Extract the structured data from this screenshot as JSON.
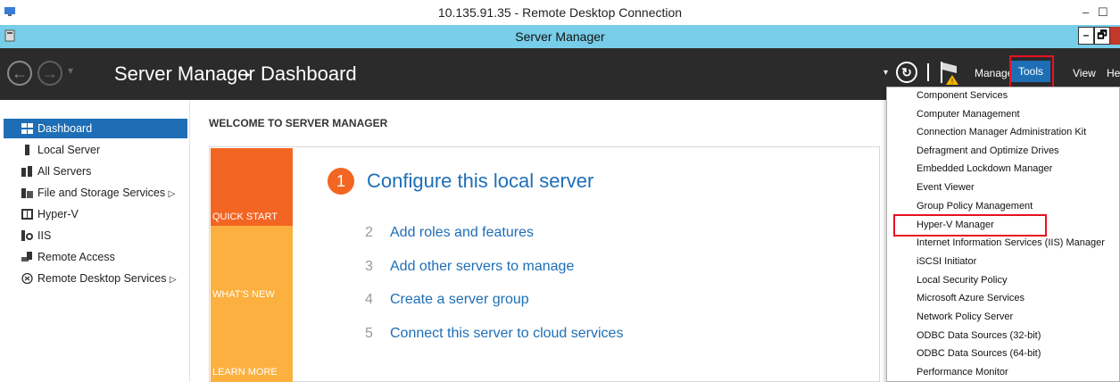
{
  "rdp": {
    "title": "10.135.91.35 - Remote Desktop Connection",
    "minimize": "–",
    "restore": "☐"
  },
  "window": {
    "title": "Server Manager",
    "minimize": "–",
    "restore": "🗗"
  },
  "header": {
    "breadcrumb_root": "Server Manager",
    "breadcrumb_sep": "▸",
    "breadcrumb_page": "Dashboard",
    "menus": {
      "manage": "Manage",
      "tools": "Tools",
      "view": "View",
      "help": "He"
    }
  },
  "sidebar": {
    "items": [
      {
        "label": "Dashboard",
        "icon": "dashboard-icon",
        "active": true
      },
      {
        "label": "Local Server",
        "icon": "server-icon"
      },
      {
        "label": "All Servers",
        "icon": "servers-icon"
      },
      {
        "label": "File and Storage Services",
        "icon": "storage-icon",
        "expand": "▷"
      },
      {
        "label": "Hyper-V",
        "icon": "hyperv-icon"
      },
      {
        "label": "IIS",
        "icon": "iis-icon"
      },
      {
        "label": "Remote Access",
        "icon": "remote-access-icon"
      },
      {
        "label": "Remote Desktop Services",
        "icon": "remote-desktop-icon",
        "expand": "▷"
      }
    ]
  },
  "main": {
    "welcome": "WELCOME TO SERVER MANAGER",
    "tiles": {
      "quick_start": "QUICK START",
      "whats_new": "WHAT'S NEW",
      "learn_more": "LEARN MORE"
    },
    "step1": {
      "num": "1",
      "label": "Configure this local server"
    },
    "steps": [
      {
        "num": "2",
        "label": "Add roles and features"
      },
      {
        "num": "3",
        "label": "Add other servers to manage"
      },
      {
        "num": "4",
        "label": "Create a server group"
      },
      {
        "num": "5",
        "label": "Connect this server to cloud services"
      }
    ]
  },
  "tools_menu": {
    "items": [
      "Component Services",
      "Computer Management",
      "Connection Manager Administration Kit",
      "Defragment and Optimize Drives",
      "Embedded Lockdown Manager",
      "Event Viewer",
      "Group Policy Management",
      "Hyper-V Manager",
      "Internet Information Services (IIS) Manager",
      "iSCSI Initiator",
      "Local Security Policy",
      "Microsoft Azure Services",
      "Network Policy Server",
      "ODBC Data Sources (32-bit)",
      "ODBC Data Sources (64-bit)",
      "Performance Monitor"
    ]
  },
  "colors": {
    "accent": "#1e6eb6",
    "orange": "#f26522",
    "yellow": "#fbb040",
    "header": "#2b2b2b",
    "titlebar": "#78cde8",
    "highlight": "#e81123"
  }
}
